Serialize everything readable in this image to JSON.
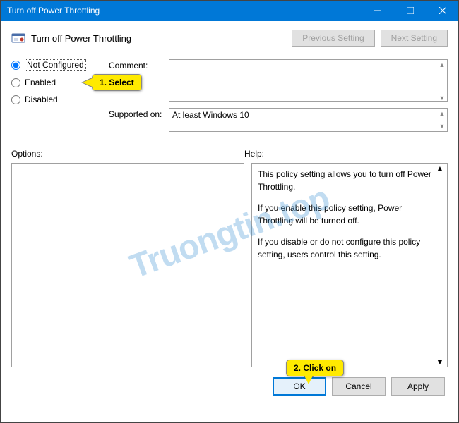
{
  "window": {
    "title": "Turn off Power Throttling"
  },
  "header": {
    "subtitle": "Turn off Power Throttling",
    "prev": "Previous Setting",
    "next": "Next Setting"
  },
  "radio": {
    "not_configured": "Not Configured",
    "enabled": "Enabled",
    "disabled": "Disabled",
    "selected": "not_configured"
  },
  "labels": {
    "comment": "Comment:",
    "supported": "Supported on:",
    "options": "Options:",
    "help": "Help:"
  },
  "supported_text": "At least Windows 10",
  "help": {
    "p1": "This policy setting allows you to turn off Power Throttling.",
    "p2": "If you enable this policy setting, Power Throttling will be turned off.",
    "p3": "If you disable or do not configure this policy setting, users control this setting."
  },
  "buttons": {
    "ok": "OK",
    "cancel": "Cancel",
    "apply": "Apply"
  },
  "callouts": {
    "select": "1. Select",
    "click": "2. Click on"
  },
  "watermark": "Truongtin.top"
}
